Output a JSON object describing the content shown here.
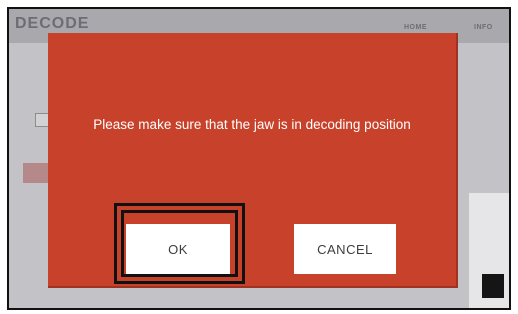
{
  "app": {
    "title": "DECODE",
    "nav": {
      "home": "HOME",
      "info": "INFO"
    }
  },
  "dialog": {
    "message": "Please make sure that the jaw is in decoding position",
    "ok_label": "OK",
    "cancel_label": "CANCEL",
    "background_color": "#c8422b",
    "highlighted_button": "OK"
  }
}
